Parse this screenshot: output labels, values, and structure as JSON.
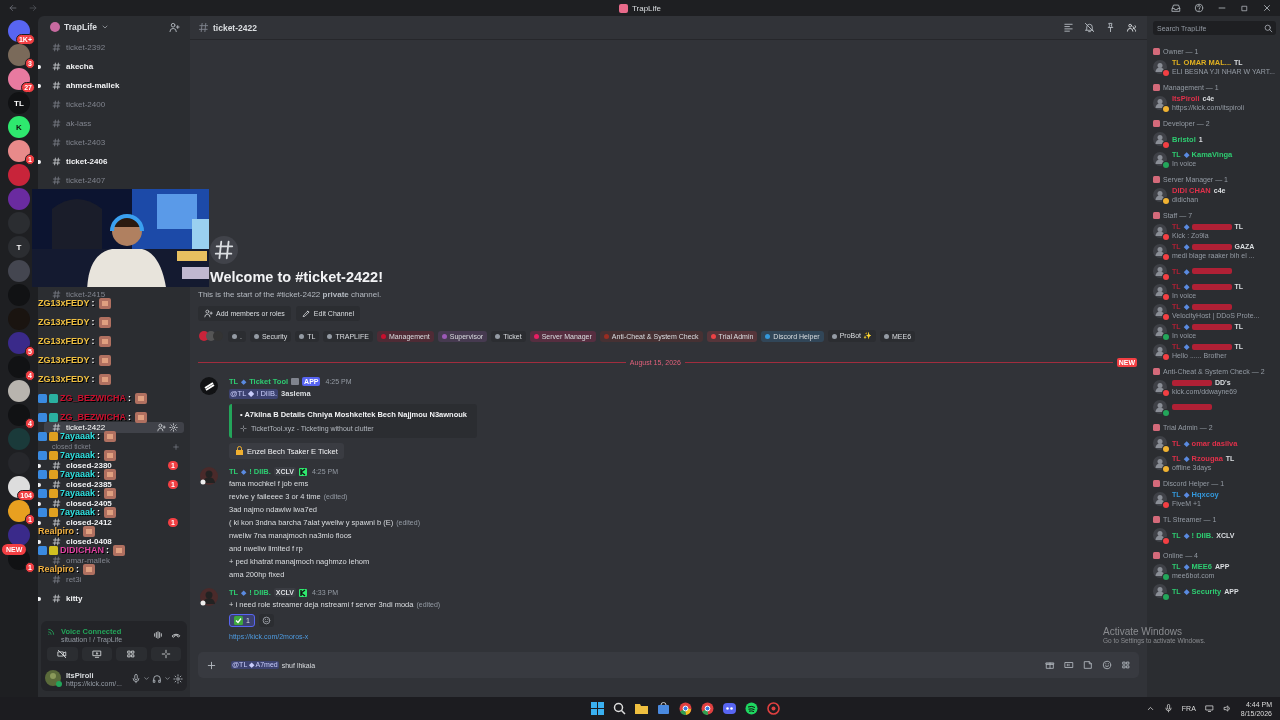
{
  "titlebar": {
    "title": "TrapLife"
  },
  "servers": [
    {
      "color": "#5865f2",
      "badge": "1K+"
    },
    {
      "color": "#7a6a5a",
      "badge": "3"
    },
    {
      "color": "#e87aa0",
      "badge": "27"
    },
    {
      "color": "#111214",
      "label": "TL"
    },
    {
      "color": "#2ee86e",
      "label": "K"
    },
    {
      "color": "#e88a8a",
      "badge": "1"
    },
    {
      "color": "#c8243a"
    },
    {
      "color": "#6a2ba0"
    },
    {
      "color": "#2b2d31"
    },
    {
      "color": "#2b2d31",
      "label": "T"
    },
    {
      "color": "#444650"
    },
    {
      "color": "#111214"
    },
    {
      "color": "#1a1410"
    },
    {
      "color": "#3a2a8a",
      "badge": "5"
    },
    {
      "color": "#111214",
      "badge": "4"
    },
    {
      "color": "#b8b4ae"
    },
    {
      "color": "#111214",
      "badge": "4"
    },
    {
      "color": "#1a3a3a"
    },
    {
      "color": "#26272b"
    },
    {
      "color": "#dddddd",
      "badge": "104"
    },
    {
      "color": "#e8a020",
      "badge": "1"
    },
    {
      "color": "#3a2a8a"
    },
    {
      "color": "#111214",
      "badge": "1",
      "pill": "NEW"
    }
  ],
  "sidebar": {
    "server_name": "TrapLife",
    "channels": [
      {
        "name": "ticket-2392",
        "unread": false,
        "selected": false
      },
      {
        "name": "akecha",
        "unread": true,
        "selected": false
      },
      {
        "name": "ahmed-mallek",
        "unread": true,
        "selected": false
      },
      {
        "name": "ticket-2400",
        "unread": false,
        "selected": false
      },
      {
        "name": "ak-lass",
        "unread": false,
        "selected": false
      },
      {
        "name": "ticket-2403",
        "unread": false,
        "selected": false
      },
      {
        "name": "ticket-2406",
        "unread": true,
        "selected": false
      },
      {
        "name": "ticket-2407",
        "unread": false,
        "selected": false
      },
      {
        "name": "ticket-2415",
        "unread": false,
        "selected": false
      },
      {
        "name": "ticket-2422",
        "unread": false,
        "selected": true
      },
      {
        "kind": "category",
        "name": "closed ticket"
      },
      {
        "name": "closed-2380",
        "unread": true,
        "selected": false,
        "mentions": "1"
      },
      {
        "name": "closed-2385",
        "unread": true,
        "selected": false,
        "mentions": "1"
      },
      {
        "name": "closed-2405",
        "unread": true,
        "selected": false
      },
      {
        "name": "closed-2412",
        "unread": true,
        "selected": false,
        "mentions": "1"
      },
      {
        "name": "closed-0408",
        "unread": true,
        "selected": false
      },
      {
        "name": "omar-mallek",
        "unread": false,
        "selected": false
      },
      {
        "name": "ret3i",
        "unread": false,
        "selected": false
      },
      {
        "name": "kitty",
        "unread": true,
        "selected": false
      }
    ],
    "voice": {
      "title": "Voice Connected",
      "channel": "situation ! / TrapLife"
    },
    "user": {
      "name": "ItsPiroli",
      "status": "https://kick.com/..."
    }
  },
  "stream_chat": [
    {
      "name": "ZG13xFEDY",
      "sep": ":",
      "color": "#f0c040"
    },
    {
      "name": "ZG13xFEDY",
      "sep": ":",
      "color": "#f0c040"
    },
    {
      "name": "ZG13xFEDY",
      "sep": ":",
      "color": "#f0c040"
    },
    {
      "name": "ZG13xFEDY",
      "sep": ":",
      "color": "#f0c040"
    },
    {
      "name": "ZG13xFEDY",
      "sep": ":",
      "color": "#f0c040"
    },
    {
      "name": "ZG_BEZWICHA",
      "sep": ":",
      "color": "#c8102e",
      "moderator": true,
      "subscriber": true
    },
    {
      "name": "ZG_BEZWICHA",
      "sep": ":",
      "color": "#c8102e",
      "moderator": true,
      "subscriber": true
    },
    {
      "name": "7ayaaak",
      "sep": ":",
      "color": "#2ee0e0",
      "moderator": true,
      "vip": true
    },
    {
      "name": "7ayaaak",
      "sep": ":",
      "color": "#2ee0e0",
      "moderator": true,
      "vip": true
    },
    {
      "name": "7ayaaak",
      "sep": ":",
      "color": "#2ee0e0",
      "moderator": true,
      "vip": true
    },
    {
      "name": "7ayaaak",
      "sep": ":",
      "color": "#2ee0e0",
      "moderator": true,
      "vip": true
    },
    {
      "name": "7ayaaak",
      "sep": ":",
      "color": "#2ee0e0",
      "moderator": true,
      "vip": true
    },
    {
      "name": "Realpiro",
      "sep": ":",
      "color": "#f0b040"
    },
    {
      "name": "DIDICHAN",
      "sep": ":",
      "color": "#e040a0",
      "moderator": true,
      "verified": true
    },
    {
      "name": "Realpiro",
      "sep": ":",
      "color": "#f0b040"
    }
  ],
  "channel_header": {
    "name": "ticket-2422"
  },
  "welcome": {
    "title": "Welcome to #ticket-2422!",
    "subtitle": "This is the start of the #ticket-2422 **private** channel.",
    "buttons": [
      {
        "kind": "add",
        "label": "Add members or roles"
      },
      {
        "kind": "edit",
        "label": "Edit Channel"
      }
    ],
    "roles": [
      {
        "name": ".",
        "color": "#949ba4"
      },
      {
        "name": "Security",
        "color": "#949ba4"
      },
      {
        "name": "TL",
        "color": "#949ba4"
      },
      {
        "name": "TRAPLIFE",
        "color": "#949ba4"
      },
      {
        "name": "Management",
        "color": "#c8102e"
      },
      {
        "name": "Supervisor",
        "color": "#9b59b6"
      },
      {
        "name": "Ticket",
        "color": "#949ba4"
      },
      {
        "name": "Server Manager",
        "color": "#e91e63"
      },
      {
        "name": "Anti-Cheat & System Check",
        "color": "#992d22"
      },
      {
        "name": "Trial Admin",
        "color": "#ed4245"
      },
      {
        "name": "Discord Helper",
        "color": "#3498db"
      },
      {
        "name": "ProBot ✨",
        "color": "#949ba4"
      },
      {
        "name": "MEE6",
        "color": "#949ba4"
      }
    ]
  },
  "divider": {
    "date": "August 15, 2026",
    "tag": "NEW"
  },
  "messages": [
    {
      "kind": "bot",
      "prefix": "TL",
      "sep": "◆",
      "author": "Ticket Tool",
      "tag": "APP",
      "time": "4:25 PM",
      "mention": "@TL ◆ ! DIIB.",
      "text": "3aslema",
      "embed": {
        "title": "• A7kilna B Details Chniya Moshkeltek Bech Najjmou N3awnouk",
        "footer": "TicketTool.xyz - Ticketing without clutter"
      },
      "button": "Enzel Bech Tsaker E Ticket"
    },
    {
      "kind": "user",
      "prefix": "TL",
      "sep": "◆",
      "author": "! DIIB.",
      "tag": "XCLV",
      "time": "4:25 PM",
      "lines": [
        {
          "text": "fama mochkel f job ems"
        },
        {
          "text": "revive y faileeee 3 or 4 time",
          "edited": "(edited)"
        },
        {
          "text": "3ad najmo ndawiw lwa7ed"
        },
        {
          "text": "( ki kon 3ndna barcha 7alat yweliw y spawni b (E)",
          "edited": "(edited)"
        },
        {
          "text": "nweliw 7na manajmoch na3mlo floos"
        },
        {
          "text": "and nweliw limited f rp"
        },
        {
          "text": "+ ped khatrat manajmoch naghmzo lehom"
        },
        {
          "text": "ama 200hp fixed"
        }
      ]
    },
    {
      "kind": "user",
      "prefix": "TL",
      "sep": "◆",
      "author": "! DIIB.",
      "tag": "XCLV",
      "time": "4:33 PM",
      "lines": [
        {
          "text": "+ i need role streamer deja nstreami f server 3ndi moda",
          "edited": "(edited)"
        }
      ],
      "reaction": {
        "count": "1",
        "selected": true
      },
      "link": "https://kick.com/2moros-x"
    }
  ],
  "composer": {
    "mention": "@TL ◆ A7med",
    "value": "shuf lhkaia"
  },
  "members": {
    "search_placeholder": "Search TrapLife",
    "groups": [
      {
        "title": "Owner — 1",
        "items": [
          {
            "prefix": "TL",
            "name": "OMAR MAL...",
            "color": "#e0b020",
            "badge": "TL",
            "status": "ELI BESNA YJI NHAR W YART...",
            "presence": {
              "color": "#f23f43"
            }
          }
        ]
      },
      {
        "title": "Management — 1",
        "items": [
          {
            "name": "ItsPiroli",
            "color": "#e0304a",
            "badge": "c4e",
            "status": "https://kick.com/itspiroli",
            "presence": {
              "color": "#f0b232"
            }
          }
        ]
      },
      {
        "title": "Developer — 2",
        "items": [
          {
            "name": "Bristol",
            "color": "#2ecc71",
            "badge": "1",
            "presence": {
              "color": "#f23f43"
            }
          },
          {
            "prefix": "TL",
            "sep": "◆",
            "name": "KamaVinga",
            "color": "#2ecc71",
            "status": "In voice",
            "presence": {
              "color": "#23a55a"
            }
          }
        ]
      },
      {
        "title": "Server Manager — 1",
        "items": [
          {
            "name": "DIDI CHAN",
            "color": "#e0304a",
            "badge": "c4e",
            "status": "didichan",
            "presence": {
              "color": "#f0b232"
            }
          }
        ]
      },
      {
        "title": "Staff — 7",
        "items": [
          {
            "prefix": "TL",
            "sep": "◆",
            "color": "#b02035",
            "badge": "TL",
            "status": "Kick : Zo9la",
            "presence": {
              "color": "#f23f43"
            }
          },
          {
            "prefix": "TL",
            "sep": "◆",
            "color": "#b02035",
            "badge": "GAZA",
            "status": "medi blage raaker bih el ...",
            "presence": {
              "color": "#f23f43"
            }
          },
          {
            "prefix": "TL",
            "sep": "◆",
            "color": "#b02035",
            "presence": {
              "color": "#f23f43"
            }
          },
          {
            "prefix": "TL",
            "sep": "◆",
            "color": "#b02035",
            "badge": "TL",
            "status": "In voice",
            "presence": {
              "color": "#f23f43"
            }
          },
          {
            "prefix": "TL",
            "sep": "◆",
            "color": "#b02035",
            "status": "VelocityHost | DDoS Prote...",
            "presence": {
              "color": "#f23f43"
            }
          },
          {
            "prefix": "TL",
            "sep": "◆",
            "color": "#b02035",
            "badge": "TL",
            "status": "In voice",
            "presence": {
              "color": "#23a55a"
            }
          },
          {
            "prefix": "TL",
            "sep": "◆",
            "color": "#b02035",
            "badge": "TL",
            "status": "Hello ...... Brother",
            "presence": {
              "color": "#f23f43"
            }
          }
        ]
      },
      {
        "title": "Anti-Cheat & System Check — 2",
        "items": [
          {
            "color": "#b02035",
            "badge": "DD's",
            "status": "kick.com/ddwayne69",
            "presence": {
              "color": "#f23f43"
            }
          },
          {
            "color": "#b02035",
            "presence": {
              "color": "#23a55a"
            }
          }
        ]
      },
      {
        "title": "Trial Admin — 2",
        "items": [
          {
            "prefix": "TL",
            "sep": "◆",
            "name": "omar dasilva",
            "color": "#e0304a",
            "presence": {
              "color": "#f0b232"
            }
          },
          {
            "prefix": "TL",
            "sep": "◆",
            "name": "Rzougaa",
            "color": "#e0304a",
            "badge": "TL",
            "status": "offline 3days",
            "presence": {
              "color": "#f0b232"
            }
          }
        ]
      },
      {
        "title": "Discord Helper — 1",
        "items": [
          {
            "prefix": "TL",
            "sep": "◆",
            "name": "Hqxcoy",
            "color": "#3498db",
            "status": "FiveM +1",
            "presence": {
              "color": "#f23f43"
            }
          }
        ]
      },
      {
        "title": "TL Streamer — 1",
        "items": [
          {
            "prefix": "TL",
            "sep": "◆",
            "name": "! DIIB.",
            "color": "#2ecc71",
            "badge": "XCLV",
            "presence": {
              "color": "#f23f43"
            }
          }
        ]
      },
      {
        "title": "Online — 4",
        "items": [
          {
            "prefix": "TL",
            "sep": "◆",
            "name": "MEE6",
            "color": "#2ecc71",
            "badge": "APP",
            "status": "mee6bot.com",
            "presence": {
              "color": "#23a55a"
            }
          },
          {
            "prefix": "TL",
            "sep": "◆",
            "name": "Security",
            "color": "#2ecc71",
            "badge": "APP",
            "presence": {
              "color": "#23a55a"
            }
          }
        ]
      }
    ]
  },
  "activation": {
    "title": "Activate Windows",
    "text": "Go to Settings to activate Windows."
  },
  "taskbar": {
    "language": "FRA",
    "time": "4:44 PM",
    "date": "8/15/2026"
  }
}
